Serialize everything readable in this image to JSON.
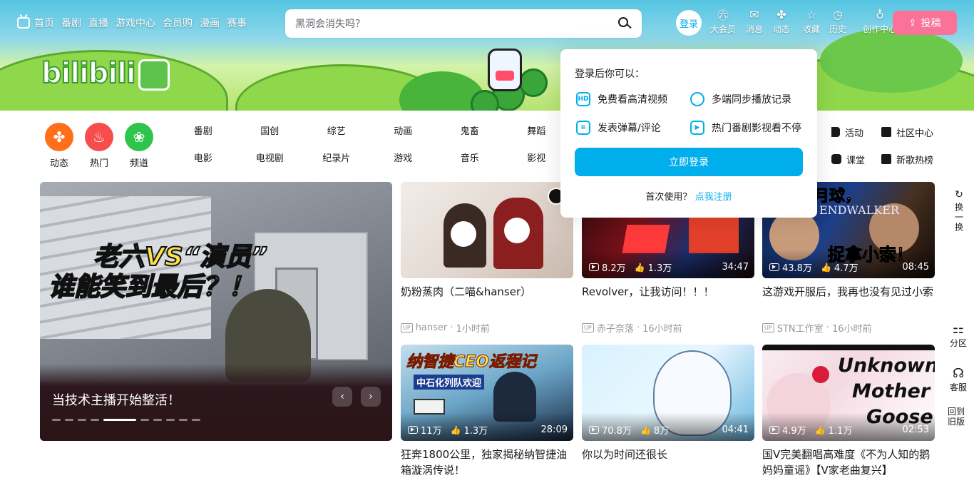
{
  "topnav": {
    "items": [
      "首页",
      "番剧",
      "直播",
      "游戏中心",
      "会员购",
      "漫画",
      "赛事"
    ],
    "search_placeholder": "黑洞会消失吗？",
    "login": "登录",
    "icons": [
      {
        "label": "大会员",
        "icon": "vip-icon"
      },
      {
        "label": "消息",
        "icon": "message-icon"
      },
      {
        "label": "动态",
        "icon": "dynamic-icon"
      },
      {
        "label": "收藏",
        "icon": "star-icon"
      },
      {
        "label": "历史",
        "icon": "history-icon"
      },
      {
        "label": "创作中心",
        "icon": "bulb-icon"
      }
    ],
    "upload": "投稿"
  },
  "channels": {
    "circles": [
      {
        "label": "动态",
        "color": "#ff6f1b"
      },
      {
        "label": "热门",
        "color": "#f74d4d"
      },
      {
        "label": "频道",
        "color": "#2fc44c"
      }
    ],
    "categories": [
      "番剧",
      "国创",
      "综艺",
      "动画",
      "鬼畜",
      "舞蹈",
      "电影",
      "电视剧",
      "纪录片",
      "游戏",
      "音乐",
      "影视"
    ],
    "extras": [
      "活动",
      "社区中心",
      "课堂",
      "新歌热榜"
    ]
  },
  "carousel": {
    "headline_1a": "老六",
    "headline_1b": "VS",
    "headline_1c": "“演员”",
    "headline_2a": "谁能",
    "headline_2b": "笑到最后",
    "headline_2c": "？！",
    "title": "当技术主播开始整活！",
    "prev": "‹",
    "next": "›",
    "dots": 10,
    "active_dot": 4
  },
  "videos": [
    {
      "title": "奶粉蒸肉（二喵&hanser）",
      "author": "hanser",
      "time": "1小时前",
      "plays": "",
      "likes": "",
      "duration": ""
    },
    {
      "title": "Revolver，让我访问！！！",
      "author": "赤子奈落",
      "time": "16小时前",
      "plays": "8.2万",
      "likes": "1.3万",
      "duration": "34:47"
    },
    {
      "title": "这游戏开服后，我再也没有见过小索",
      "author": "STN工作室",
      "time": "16小时前",
      "plays": "43.8万",
      "likes": "4.7万",
      "duration": "08:45"
    },
    {
      "title": "狂奔1800公里，独家揭秘纳智捷油箱漩涡传说！",
      "author": "",
      "time": "",
      "plays": "11万",
      "likes": "1.3万",
      "duration": "28:09"
    },
    {
      "title": "你以为时间还很长",
      "author": "",
      "time": "",
      "plays": "70.8万",
      "likes": "8万",
      "duration": "04:41"
    },
    {
      "title": "国V完美翻唱高难度《不为人知的鹅妈妈童谣》【V家老曲复兴】",
      "author": "",
      "time": "",
      "plays": "4.9万",
      "likes": "1.1万",
      "duration": "02:53"
    }
  ],
  "thumb_text": {
    "v3": "捉拿小索！",
    "v3b": "月球，",
    "v3c": "ENDWALKER",
    "v4": "纳智捷CEO返程记",
    "v4b": "中石化列队欢迎",
    "v6a": "Unknown",
    "v6b": "Mother",
    "v6c": "Goose"
  },
  "popup": {
    "heading": "登录后你可以：",
    "features": [
      {
        "label": "免费看高清视频",
        "icon": "hd-icon",
        "glyph": "HD"
      },
      {
        "label": "多端同步播放记录",
        "icon": "clock-icon",
        "glyph": ""
      },
      {
        "label": "发表弹幕/评论",
        "icon": "danmaku-icon",
        "glyph": "≡"
      },
      {
        "label": "热门番剧影视看不停",
        "icon": "play-icon",
        "glyph": "▶"
      }
    ],
    "button": "立即登录",
    "register_prefix": "首次使用？",
    "register_link": "点我注册"
  },
  "side": {
    "refresh": "换一换",
    "partition": "分区",
    "service": "客服",
    "old_version": "回到旧版"
  },
  "colors": {
    "accent": "#00aeec",
    "pink": "#fb7299"
  }
}
